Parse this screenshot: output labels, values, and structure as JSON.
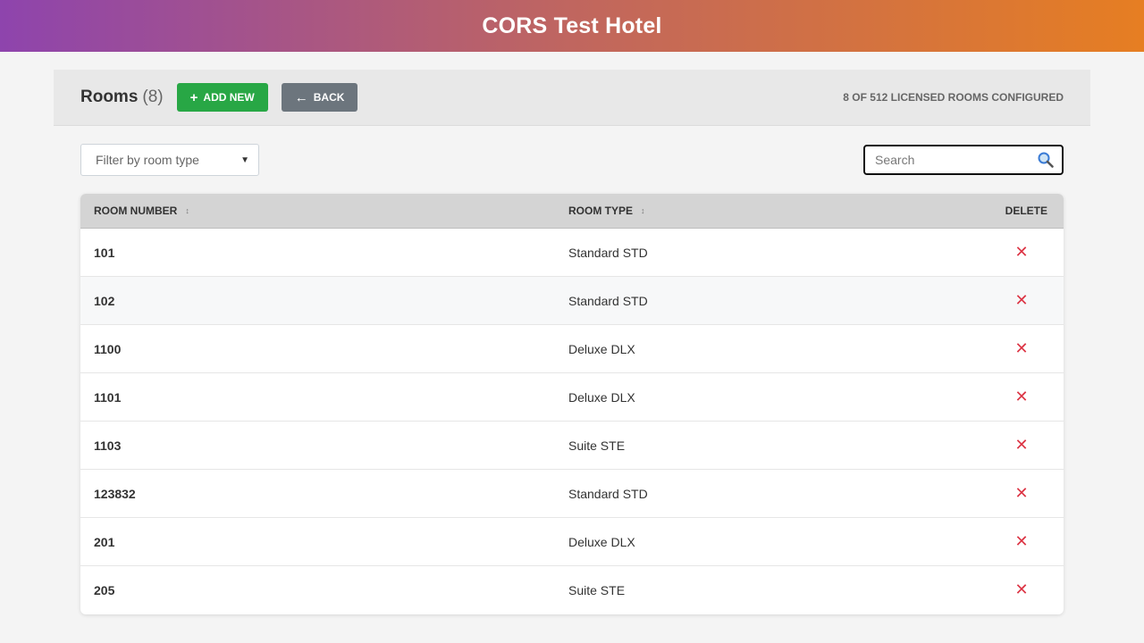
{
  "header": {
    "title": "CORS Test Hotel"
  },
  "toolbar": {
    "title": "Rooms",
    "count": "(8)",
    "add_label": "Add New",
    "back_label": "Back",
    "license_text": "8 of 512 licensed rooms configured"
  },
  "filters": {
    "room_type_placeholder": "Filter by room type",
    "search_placeholder": "Search"
  },
  "table": {
    "columns": {
      "room_number": "Room Number",
      "room_type": "Room Type",
      "delete": "Delete"
    },
    "delete_glyph": "✕",
    "rows": [
      {
        "number": "101",
        "type": "Standard STD"
      },
      {
        "number": "102",
        "type": "Standard STD"
      },
      {
        "number": "1100",
        "type": "Deluxe DLX"
      },
      {
        "number": "1101",
        "type": "Deluxe DLX"
      },
      {
        "number": "1103",
        "type": "Suite STE"
      },
      {
        "number": "123832",
        "type": "Standard STD"
      },
      {
        "number": "201",
        "type": "Deluxe DLX"
      },
      {
        "number": "205",
        "type": "Suite STE"
      }
    ]
  },
  "colors": {
    "header_gradient_start": "#8e44ad",
    "header_gradient_end": "#e67e22",
    "add_button": "#28a745",
    "back_button": "#6c757d",
    "delete_icon": "#dc3545"
  },
  "icons": {
    "add": "plus-icon",
    "back": "arrow-left-icon",
    "search": "search-icon",
    "sort": "sort-icon",
    "delete": "close-icon",
    "select": "chevron-down-icon"
  }
}
